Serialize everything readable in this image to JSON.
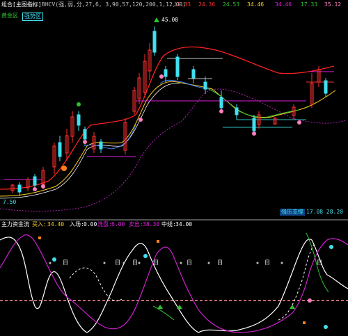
{
  "colors": {
    "bg": "#000000",
    "up": "#ff3030",
    "down": "#40e0f0",
    "white": "#ffffff",
    "yellow": "#ffd020",
    "magenta": "#e020e0",
    "purple": "#a020a0",
    "pink": "#ff80c0",
    "green": "#20c020",
    "blue": "#4080ff",
    "orange": "#ff8020",
    "cyan": "#00e0ff",
    "grey": "#c0c0c0",
    "dashred": "#ff6060"
  },
  "header": {
    "title": "组合[主图指标]",
    "params": "BHCV(强,弱,分,27,6, 3,90,57,120,200,1,12,00)",
    "v1": "17.33",
    "v2": "24.36",
    "v3": "24.53",
    "v4": "34.46",
    "v5": "34.46",
    "v6": "17.33",
    "v7": "35.12"
  },
  "subheader": {
    "left": "黄金区",
    "tag": "强势区"
  },
  "top_price": "45.08",
  "low_price": "7.50",
  "right_label": "强压支撑",
  "right_vals": "17.08  28.20",
  "sub_panel": {
    "name": "主力资金流",
    "items": [
      {
        "label": "买入:",
        "value": "34.40"
      },
      {
        "label": "入场:",
        "value": "0.00"
      },
      {
        "label": "洗盘:",
        "value": "6.00"
      },
      {
        "label": "卖出:",
        "value": "38.30"
      },
      {
        "label": "中线:",
        "value": "34.00"
      }
    ]
  },
  "labels": [
    "日",
    "日",
    "日",
    "日",
    "日",
    "日",
    "日",
    "日"
  ]
}
